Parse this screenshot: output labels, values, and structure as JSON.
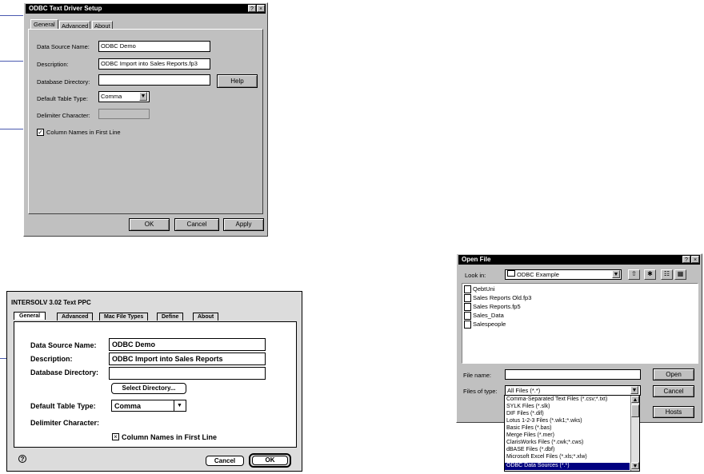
{
  "win_dialog": {
    "title": "ODBC Text Driver Setup",
    "help_btn": "?",
    "close_btn": "×",
    "tabs": [
      "General",
      "Advanced",
      "About"
    ],
    "data_source_label": "Data Source Name:",
    "data_source_value": "ODBC Demo",
    "description_label": "Description:",
    "description_value": "ODBC Import into Sales Reports.fp3",
    "database_dir_label": "Database Directory:",
    "database_dir_value": "",
    "help_label": "Help",
    "default_table_type_label": "Default Table Type:",
    "default_table_type_value": "Comma",
    "delimiter_label": "Delimiter Character:",
    "column_names_label": "Column Names in First Line",
    "ok_label": "OK",
    "cancel_label": "Cancel",
    "apply_label": "Apply"
  },
  "mac_dialog": {
    "title": "INTERSOLV 3.02 Text PPC",
    "tabs": [
      "General",
      "Advanced",
      "Mac File Types",
      "Define",
      "About"
    ],
    "data_source_label": "Data Source Name:",
    "data_source_value": "ODBC Demo",
    "description_label": "Description:",
    "description_value": "ODBC Import into Sales Reports",
    "database_dir_label": "Database Directory:",
    "database_dir_value": "",
    "select_dir_label": "Select Directory...",
    "default_table_type_label": "Default Table Type:",
    "default_table_type_value": "Comma",
    "delimiter_label": "Delimiter Character:",
    "column_names_label": "Column Names in First Line",
    "help_icon": "?",
    "cancel_label": "Cancel",
    "ok_label": "OK"
  },
  "open_file": {
    "title": "Open File",
    "help_btn": "?",
    "close_btn": "×",
    "look_in_label": "Look in:",
    "look_in_value": "ODBC Example",
    "files": [
      "QebtUni",
      "Sales Reports Old.fp3",
      "Sales Reports.fp5",
      "Sales_Data",
      "Salespeople"
    ],
    "file_name_label": "File name:",
    "file_name_value": "",
    "files_of_type_label": "Files of type:",
    "files_of_type_value": "All Files (*.*)",
    "open_label": "Open",
    "cancel_label": "Cancel",
    "hosts_label": "Hosts",
    "type_options": [
      "Comma-Separated Text Files (*.csv;*.txt)",
      "SYLK Files (*.slk)",
      "DIF Files (*.dif)",
      "Lotus 1-2-3 Files (*.wk1;*.wks)",
      "Basic Files (*.bas)",
      "Merge Files (*.mer)",
      "ClarisWorks Files (*.cwk;*.cws)",
      "dBASE Files (*.dbf)",
      "Microsoft Excel Files (*.xls;*.xlw)",
      "ODBC Data Sources (*.*)"
    ]
  }
}
